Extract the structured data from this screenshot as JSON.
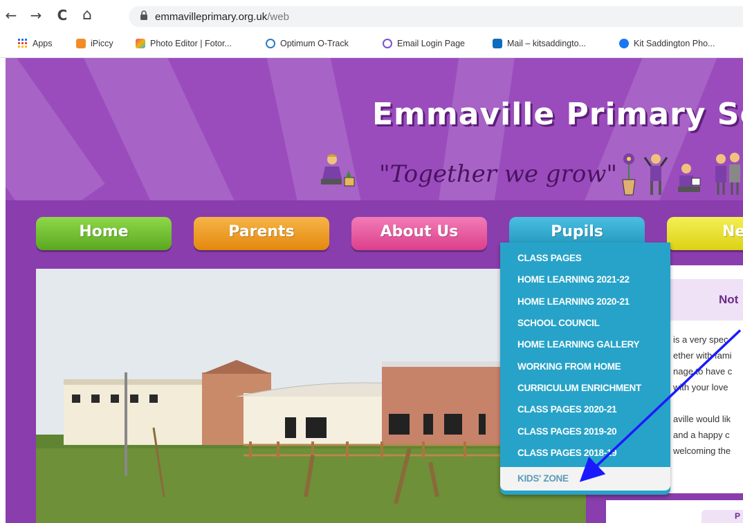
{
  "browser": {
    "back_icon": "←",
    "forward_icon": "→",
    "reload_icon": "C",
    "home_icon": "⌂",
    "lock_icon": "🔒",
    "url_host": "emmavilleprimary.org.uk",
    "url_path": "/web",
    "bookmarks": [
      {
        "label": "Apps",
        "icon": "apps-grid-icon",
        "color": "#1a73e8"
      },
      {
        "label": "iPiccy",
        "icon": "ipiccy-icon",
        "color": "#f28c28"
      },
      {
        "label": "Photo Editor | Fotor...",
        "icon": "fotor-icon",
        "color": "#e0a020"
      },
      {
        "label": "Optimum O-Track",
        "icon": "otrack-icon",
        "color": "#2b7bc4"
      },
      {
        "label": "Email Login Page",
        "icon": "email-icon",
        "color": "#7a4fcf"
      },
      {
        "label": "Mail – kitsaddingto...",
        "icon": "outlook-icon",
        "color": "#0f6cbd"
      },
      {
        "label": "Kit Saddington Pho...",
        "icon": "facebook-icon",
        "color": "#1877f2"
      }
    ]
  },
  "site": {
    "title": "Emmaville Primary Sch",
    "tagline": "\"Together we grow\"",
    "nav": [
      {
        "label": "Home",
        "color": "#6cbf2a"
      },
      {
        "label": "Parents",
        "color": "#ef9a1a"
      },
      {
        "label": "About Us",
        "color": "#e9539c"
      },
      {
        "label": "Pupils",
        "color": "#27a3c9"
      },
      {
        "label": "Nev",
        "color": "#e8e023"
      }
    ],
    "pupils_menu": [
      "CLASS PAGES",
      "HOME LEARNING 2021-22",
      "HOME LEARNING 2020-21",
      "SCHOOL COUNCIL",
      "HOME LEARNING GALLERY",
      "WORKING FROM HOME",
      "CURRICULUM ENRICHMENT",
      "CLASS PAGES 2020-21",
      "CLASS PAGES 2019-20",
      "CLASS PAGES 2018-19",
      "KIDS' ZONE"
    ],
    "notice": {
      "title": "Not",
      "lines": [
        "is a very spec",
        "ether with fami",
        "nage to have c",
        "with your love",
        "aville would lik",
        "and a happy c",
        "welcoming the"
      ],
      "panel2_text": "P"
    }
  },
  "colors": {
    "site_bg": "#8a3dad",
    "header_bg": "#9a4cbd",
    "dropdown_bg": "#27a3c9",
    "arrow": "#1a1aff"
  }
}
